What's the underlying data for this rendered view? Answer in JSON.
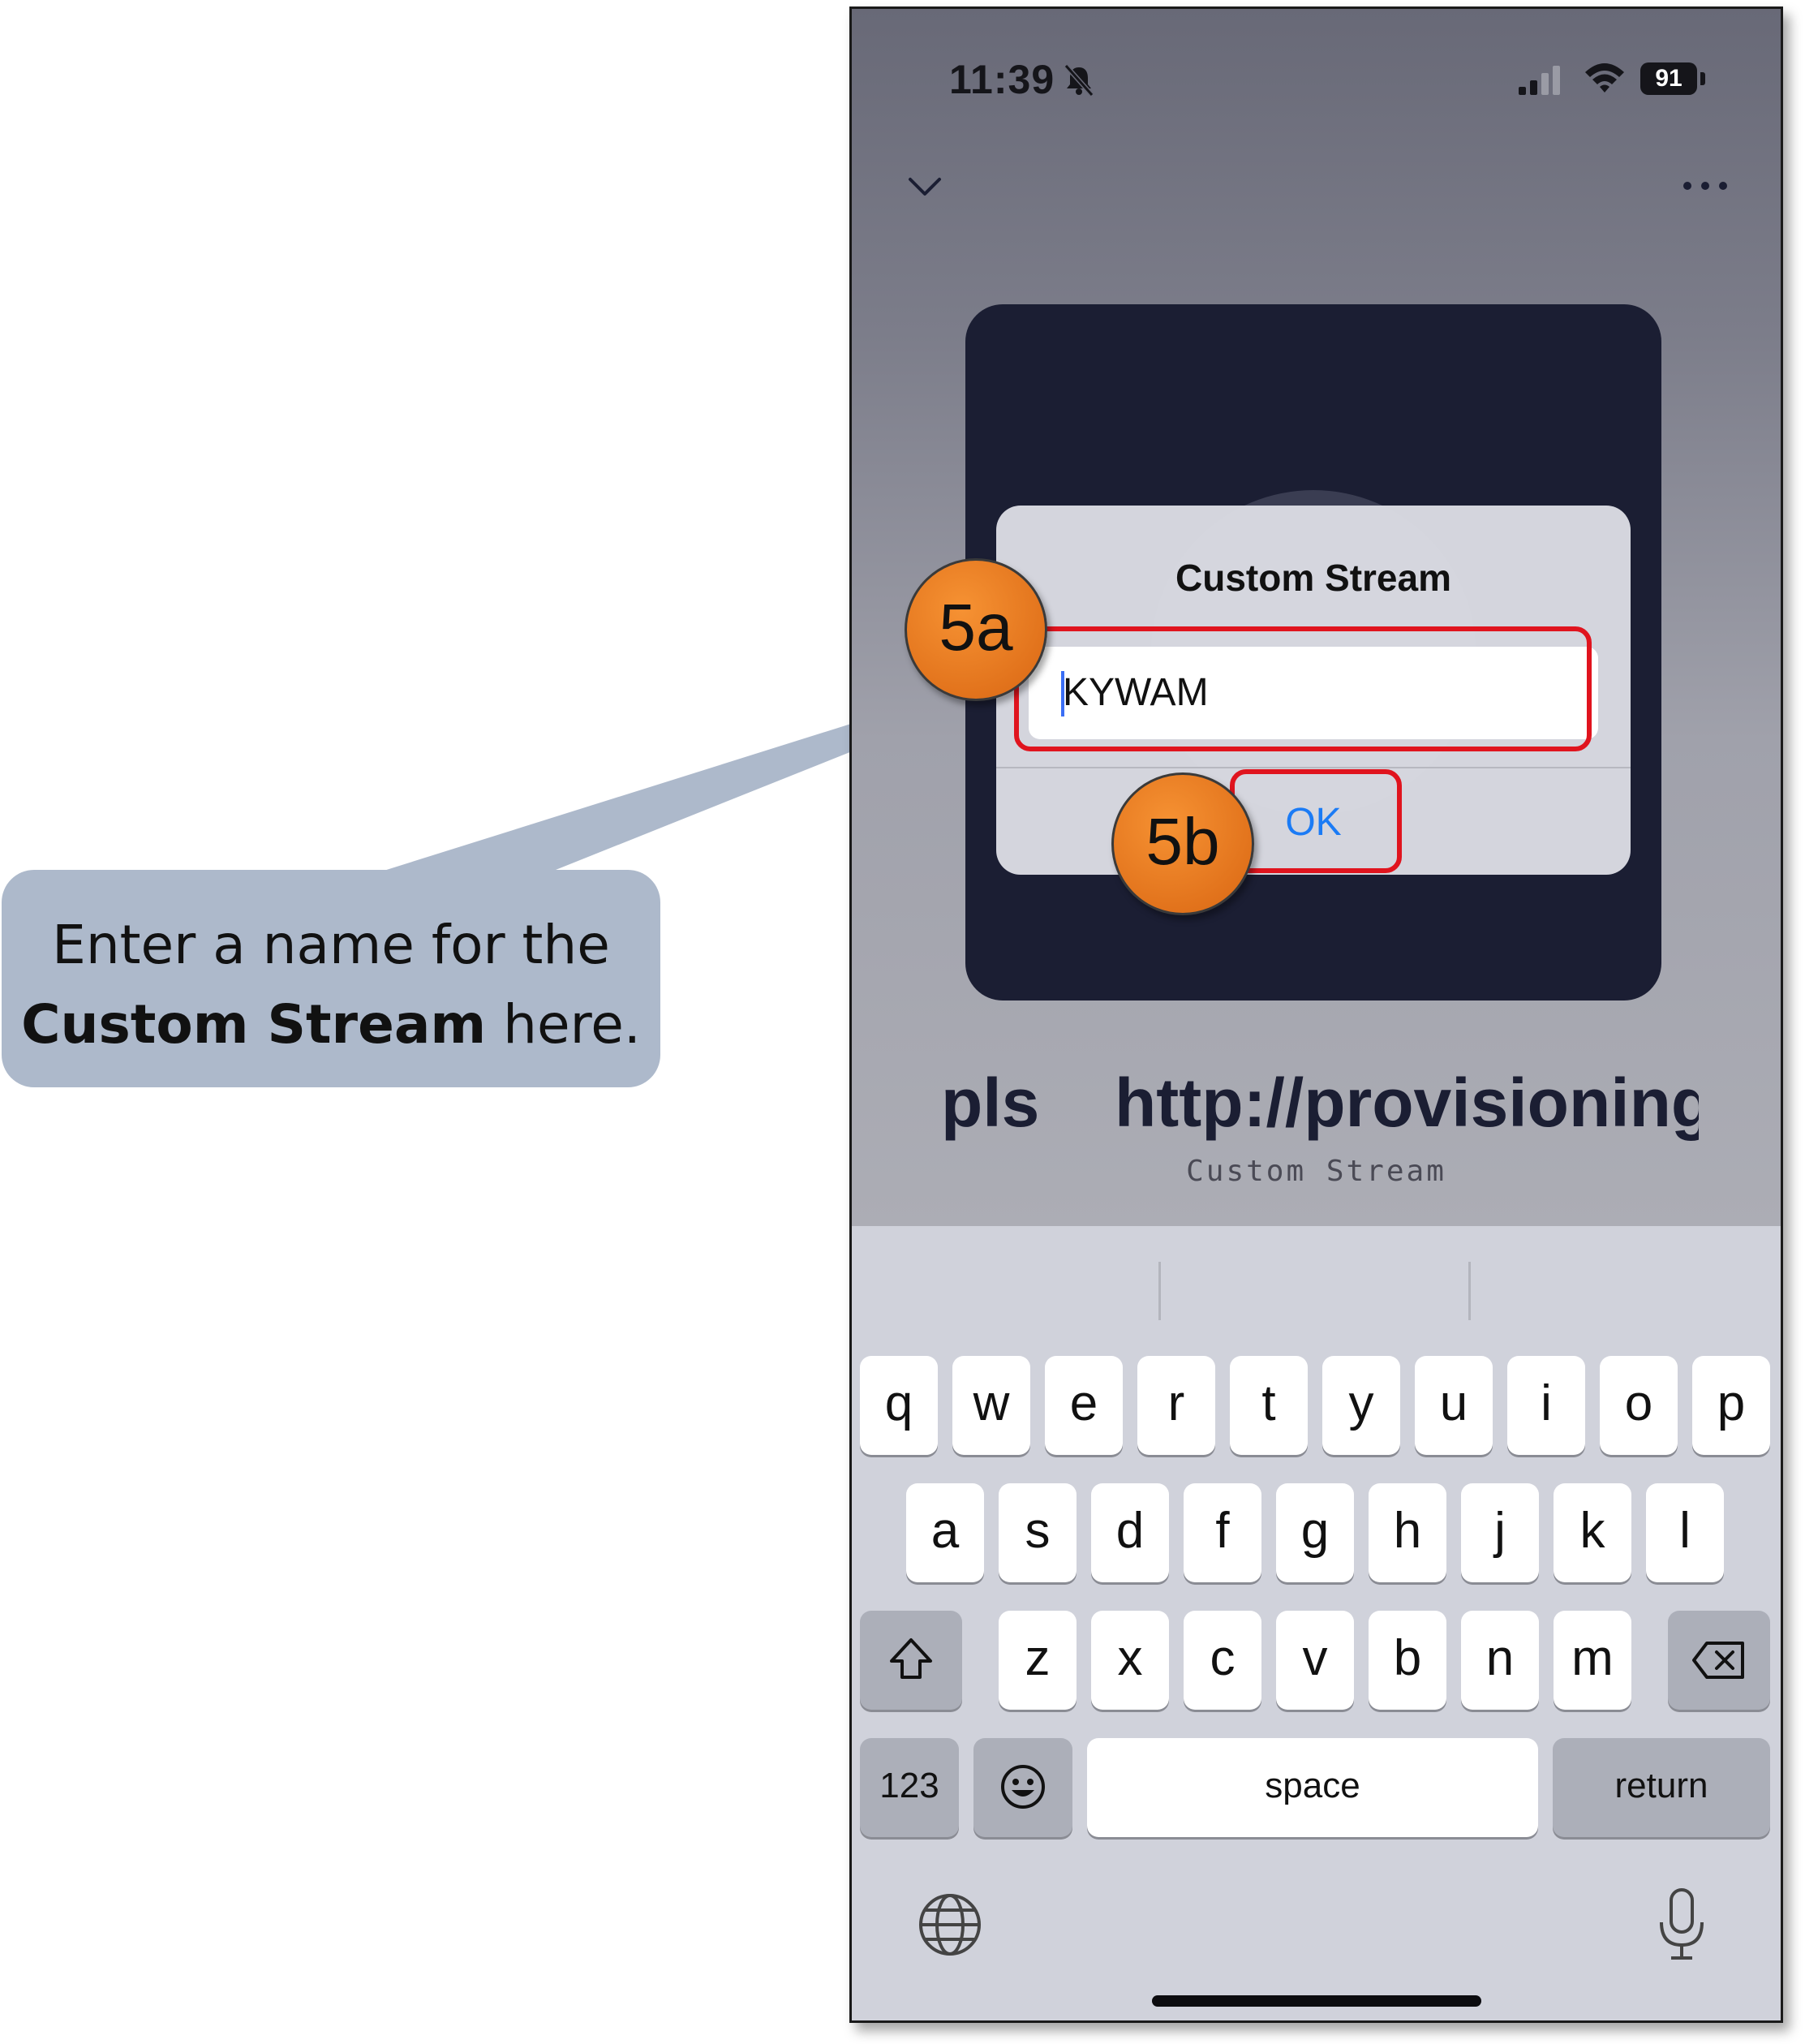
{
  "status_bar": {
    "time": "11:39",
    "battery": "91"
  },
  "player": {
    "title_left": "pls",
    "title_main": "http://provisioning",
    "subtitle": "Custom Stream"
  },
  "dialog": {
    "title": "Custom Stream",
    "input_value": "KYWAM",
    "ok_label": "OK"
  },
  "keyboard": {
    "row1": [
      "q",
      "w",
      "e",
      "r",
      "t",
      "y",
      "u",
      "i",
      "o",
      "p"
    ],
    "row2": [
      "a",
      "s",
      "d",
      "f",
      "g",
      "h",
      "j",
      "k",
      "l"
    ],
    "row3": [
      "z",
      "x",
      "c",
      "v",
      "b",
      "n",
      "m"
    ],
    "numbers_label": "123",
    "space_label": "space",
    "return_label": "return"
  },
  "annotations": {
    "badge_a": "5a",
    "badge_b": "5b",
    "callout_line1": "Enter a name for the",
    "callout_bold": "Custom Stream",
    "callout_tail": " here.",
    "badge_color": "#e97a22",
    "highlight_color": "#e0141e",
    "callout_color": "#adb9cb"
  },
  "icons": {
    "mute": "bell-slash-icon",
    "collapse": "chevron-down-icon",
    "more": "ellipsis-icon",
    "shift": "shift-icon",
    "delete": "backspace-icon",
    "emoji": "emoji-icon",
    "globe": "globe-icon",
    "dictation": "microphone-icon"
  },
  "colors": {
    "artwork_bg": "#1b1e33",
    "ok_blue": "#1b7bf5",
    "keyboard_bg": "#d0d2db"
  }
}
